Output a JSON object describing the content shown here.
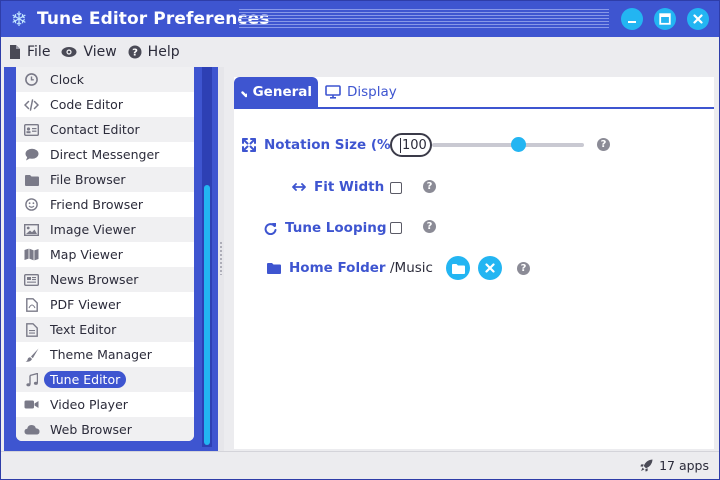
{
  "window": {
    "title": "Tune Editor Preferences"
  },
  "menu": {
    "items": [
      {
        "label": "File",
        "icon": "file-icon"
      },
      {
        "label": "View",
        "icon": "eye-icon"
      },
      {
        "label": "Help",
        "icon": "help-circle-icon"
      }
    ]
  },
  "sidebar": {
    "items": [
      {
        "label": "Clock",
        "icon": "clock-icon"
      },
      {
        "label": "Code Editor",
        "icon": "code-icon"
      },
      {
        "label": "Contact Editor",
        "icon": "address-card-icon"
      },
      {
        "label": "Direct Messenger",
        "icon": "comment-icon"
      },
      {
        "label": "File Browser",
        "icon": "folder-icon"
      },
      {
        "label": "Friend Browser",
        "icon": "smiley-icon"
      },
      {
        "label": "Image Viewer",
        "icon": "image-icon"
      },
      {
        "label": "Map Viewer",
        "icon": "map-icon"
      },
      {
        "label": "News Browser",
        "icon": "newspaper-icon"
      },
      {
        "label": "PDF Viewer",
        "icon": "pdf-file-icon"
      },
      {
        "label": "Text Editor",
        "icon": "text-file-icon"
      },
      {
        "label": "Theme Manager",
        "icon": "paintbrush-icon"
      },
      {
        "label": "Tune Editor",
        "icon": "music-note-icon",
        "selected": true
      },
      {
        "label": "Video Player",
        "icon": "video-camera-icon"
      },
      {
        "label": "Web Browser",
        "icon": "cloud-icon"
      }
    ]
  },
  "tabs": [
    {
      "label": "General",
      "active": true
    },
    {
      "label": "Display",
      "active": false
    }
  ],
  "settings": {
    "notation_size": {
      "label": "Notation Size (%)",
      "value": "100",
      "slider_fraction": 0.58
    },
    "fit_width": {
      "label": "Fit Width",
      "checked": false
    },
    "tune_looping": {
      "label": "Tune Looping",
      "checked": false
    },
    "home_folder": {
      "label": "Home Folder",
      "value": "/Music"
    }
  },
  "status": {
    "text": "17 apps"
  },
  "colors": {
    "accent": "#3e55d0",
    "highlight": "#23b5f2"
  }
}
